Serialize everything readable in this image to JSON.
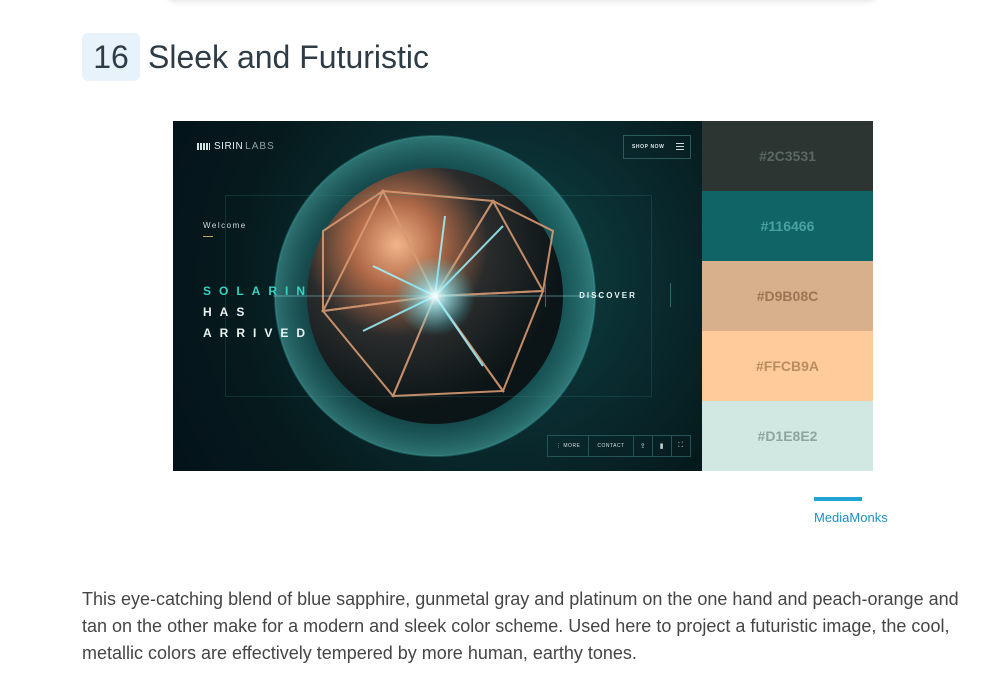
{
  "section": {
    "number": "16",
    "title": "Sleek and Futuristic"
  },
  "hero": {
    "logo_brand": "SIRIN",
    "logo_sub": "LABS",
    "shop_button": "SHOP NOW",
    "welcome": "Welcome",
    "headline_accent": "SOLARIN",
    "headline_line2": "HAS",
    "headline_line3": "ARRIVED",
    "discover": "DISCOVER",
    "bottom_more": "⋮ MORE",
    "bottom_contact": "CONTACT"
  },
  "palette": [
    {
      "hex": "#2C3531",
      "label_color": "#5b6763"
    },
    {
      "hex": "#116466",
      "label_color": "#4aa1a2"
    },
    {
      "hex": "#D9B08C",
      "label_color": "#9c7555"
    },
    {
      "hex": "#FFCB9A",
      "label_color": "#b88d62"
    },
    {
      "hex": "#D1E8E2",
      "label_color": "#8ea49f"
    }
  ],
  "caption": "MediaMonks",
  "description": "This eye-catching blend of blue sapphire, gunmetal gray and platinum on the one hand and peach-orange and tan on the other make for a modern and sleek color scheme. Used here to project a futuristic image, the cool, metallic colors are effectively tempered by more human, earthy tones."
}
